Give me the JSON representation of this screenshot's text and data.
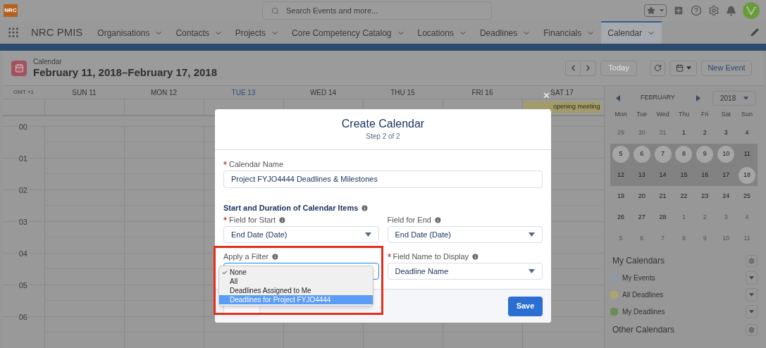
{
  "header": {
    "logo": "NRC",
    "search": {
      "placeholder": "Search Events and more..."
    }
  },
  "nav": {
    "app_name": "NRC PMIS",
    "tabs": [
      {
        "label": "Organisations",
        "selected": false
      },
      {
        "label": "Contacts",
        "selected": false
      },
      {
        "label": "Projects",
        "selected": false
      },
      {
        "label": "Core Competency Catalog",
        "selected": false
      },
      {
        "label": "Locations",
        "selected": false
      },
      {
        "label": "Deadlines",
        "selected": false
      },
      {
        "label": "Financials",
        "selected": false
      },
      {
        "label": "Calendar",
        "selected": true
      }
    ]
  },
  "calendar": {
    "label": "Calendar",
    "title": "February 11, 2018–February 17, 2018",
    "today_button": {
      "label": "Today",
      "disabled": true
    },
    "new_event": "New Event",
    "timezone": "GMT +1",
    "days": [
      {
        "label": "SUN 11",
        "today": false
      },
      {
        "label": "MON 12",
        "today": false
      },
      {
        "label": "TUE 13",
        "today": true
      },
      {
        "label": "WED 14",
        "today": false
      },
      {
        "label": "THU 15",
        "today": false
      },
      {
        "label": "FRI 16",
        "today": false
      },
      {
        "label": "SAT 17",
        "today": false
      }
    ],
    "all_day_event": {
      "title": "opening meeting"
    },
    "hours": [
      "00",
      "01",
      "02",
      "03",
      "04",
      "05",
      "06"
    ]
  },
  "mini_calendar": {
    "month": "FEBRUARY",
    "year": "2018",
    "weekdays": [
      "Mon",
      "Tue",
      "Wed",
      "Thu",
      "Fri",
      "Sat",
      "Sun"
    ],
    "weeks": [
      {
        "highlighted": false,
        "days": [
          {
            "label": "29",
            "muted": true,
            "circled": false
          },
          {
            "label": "30",
            "muted": true,
            "circled": false
          },
          {
            "label": "31",
            "muted": true,
            "circled": false
          },
          {
            "label": "1",
            "muted": false,
            "circled": false
          },
          {
            "label": "2",
            "muted": false,
            "circled": false
          },
          {
            "label": "3",
            "muted": false,
            "circled": false
          },
          {
            "label": "4",
            "muted": false,
            "circled": false
          }
        ]
      },
      {
        "highlighted": true,
        "days": [
          {
            "label": "5",
            "muted": false,
            "circled": true
          },
          {
            "label": "6",
            "muted": false,
            "circled": true
          },
          {
            "label": "7",
            "muted": false,
            "circled": true
          },
          {
            "label": "8",
            "muted": false,
            "circled": true
          },
          {
            "label": "9",
            "muted": false,
            "circled": true
          },
          {
            "label": "10",
            "muted": false,
            "circled": true
          },
          {
            "label": "11",
            "muted": false,
            "circled": false
          }
        ]
      },
      {
        "highlighted": true,
        "days": [
          {
            "label": "12",
            "muted": false,
            "circled": false
          },
          {
            "label": "13",
            "muted": false,
            "circled": false
          },
          {
            "label": "14",
            "muted": false,
            "circled": false
          },
          {
            "label": "15",
            "muted": false,
            "circled": false
          },
          {
            "label": "16",
            "muted": false,
            "circled": false
          },
          {
            "label": "17",
            "muted": false,
            "circled": false
          },
          {
            "label": "18",
            "muted": false,
            "circled": true
          }
        ]
      },
      {
        "highlighted": false,
        "days": [
          {
            "label": "19",
            "muted": false,
            "circled": false
          },
          {
            "label": "20",
            "muted": false,
            "circled": false
          },
          {
            "label": "21",
            "muted": false,
            "circled": false
          },
          {
            "label": "22",
            "muted": false,
            "circled": false
          },
          {
            "label": "23",
            "muted": false,
            "circled": false
          },
          {
            "label": "24",
            "muted": false,
            "circled": false
          },
          {
            "label": "25",
            "muted": false,
            "circled": false
          }
        ]
      },
      {
        "highlighted": false,
        "days": [
          {
            "label": "26",
            "muted": false,
            "circled": false
          },
          {
            "label": "27",
            "muted": false,
            "circled": false
          },
          {
            "label": "28",
            "muted": false,
            "circled": false
          },
          {
            "label": "1",
            "muted": true,
            "circled": false
          },
          {
            "label": "2",
            "muted": true,
            "circled": false
          },
          {
            "label": "3",
            "muted": true,
            "circled": false
          },
          {
            "label": "4",
            "muted": true,
            "circled": false
          }
        ]
      },
      {
        "highlighted": false,
        "days": [
          {
            "label": "5",
            "muted": true,
            "circled": false
          },
          {
            "label": "6",
            "muted": true,
            "circled": false
          },
          {
            "label": "7",
            "muted": true,
            "circled": false
          },
          {
            "label": "8",
            "muted": true,
            "circled": false
          },
          {
            "label": "9",
            "muted": true,
            "circled": false
          },
          {
            "label": "10",
            "muted": true,
            "circled": false
          },
          {
            "label": "11",
            "muted": true,
            "circled": false
          }
        ]
      }
    ]
  },
  "my_calendars": {
    "title": "My Calendars",
    "items": [
      {
        "label": "My Events",
        "color": "#8e9aaa"
      },
      {
        "label": "All Deadlines",
        "color": "#ada56e"
      },
      {
        "label": "My Deadlines",
        "color": "#6d8c5a"
      }
    ]
  },
  "other_calendars": {
    "title": "Other Calendars"
  },
  "modal": {
    "title": "Create Calendar",
    "step": "Step 2 of 2",
    "calendar_name": {
      "label": "Calendar Name",
      "required": true,
      "value": "Project FYJO4444 Deadlines & Milestones"
    },
    "section": "Start and Duration of Calendar Items",
    "field_for_start": {
      "label": "Field for Start",
      "required": true,
      "value": "End Date (Date)"
    },
    "field_for_end": {
      "label": "Field for End",
      "required": false,
      "value": "End Date (Date)"
    },
    "filter": {
      "label": "Apply a Filter",
      "required": false,
      "options": [
        {
          "label": "None",
          "checked": true,
          "selected": false
        },
        {
          "label": "All",
          "checked": false,
          "selected": false
        },
        {
          "label": "Deadlines Assigned to Me",
          "checked": false,
          "selected": false
        },
        {
          "label": "Deadlines for Project FYJO4444",
          "checked": false,
          "selected": true
        }
      ]
    },
    "display_field": {
      "label": "Field Name to Display",
      "required": true,
      "value": "Deadline Name"
    },
    "save": "Save"
  }
}
